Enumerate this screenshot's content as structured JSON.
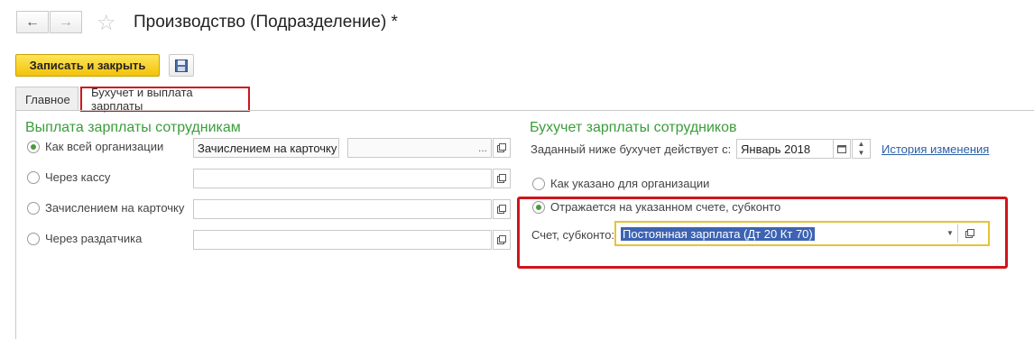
{
  "toolbar": {
    "back_icon": "arrow-left-icon",
    "forward_icon": "arrow-right-icon",
    "favorite_icon": "star-icon",
    "title": "Производство (Подразделение) *",
    "save_close_label": "Записать и закрыть",
    "save_icon": "floppy-disk-icon"
  },
  "tabs": [
    {
      "label": "Главное"
    },
    {
      "label": "Бухучет и выплата зарплаты"
    }
  ],
  "left_section": {
    "title": "Выплата зарплаты сотрудникам",
    "options": [
      {
        "label": "Как всей организации",
        "checked": true,
        "value": "Зачислением на карточку",
        "value2": ""
      },
      {
        "label": "Через кассу",
        "checked": false,
        "value": ""
      },
      {
        "label": "Зачислением на карточку",
        "checked": false,
        "value": ""
      },
      {
        "label": "Через раздатчика",
        "checked": false,
        "value": ""
      }
    ]
  },
  "right_section": {
    "title": "Бухучет зарплаты сотрудников",
    "effective_label": "Заданный ниже бухучет действует с:",
    "effective_value": "Январь 2018",
    "history_link": "История изменения",
    "option_org": "Как указано для организации",
    "option_account": "Отражается на указанном счете, субконто",
    "account_label": "Счет, субконто:",
    "account_value": "Постоянная зарплата (Дт 20 Кт 70)"
  }
}
